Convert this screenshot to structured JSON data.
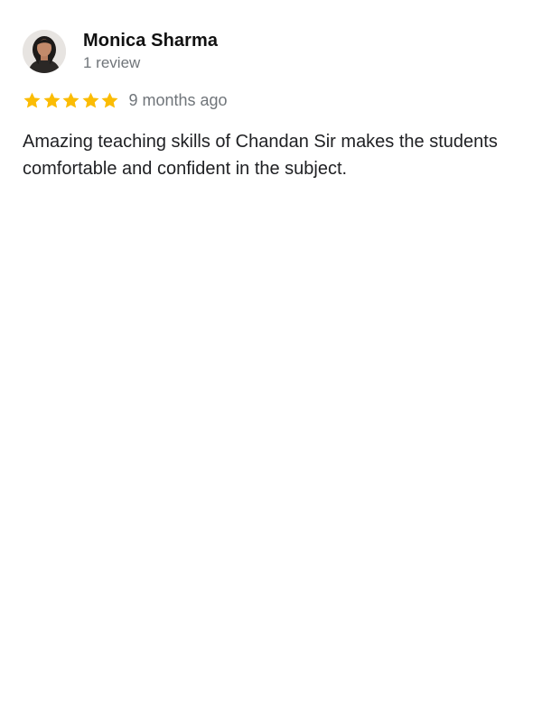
{
  "review": {
    "author_name": "Monica Sharma",
    "author_review_count": "1 review",
    "rating": 5,
    "max_rating": 5,
    "time_ago": "9 months ago",
    "text": "Amazing teaching skills of Chandan Sir makes the students comfortable and confident in the subject.",
    "star_color": "#fbbc04"
  },
  "icons": {
    "avatar": "avatar-photo",
    "star": "star-icon"
  }
}
